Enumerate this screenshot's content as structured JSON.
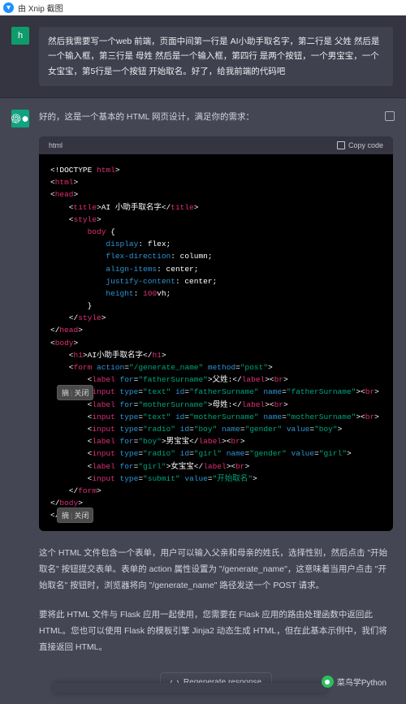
{
  "titlebar": {
    "text": "由 Xnip 截图"
  },
  "user": {
    "avatar_letter": "h",
    "message": "然后我需要写一个web 前端，页面中间第一行是 AI小助手取名字，第二行是 父姓 然后是一个输入框，第三行是 母姓 然后是一个输入框，第四行 是两个按钮，一个男宝宝，一个女宝宝，第5行是一个按钮 开始取名。好了，给我前端的代码吧"
  },
  "assistant": {
    "intro": "好的，这是一个基本的 HTML 网页设计，满足你的需求：",
    "code_lang": "html",
    "copy_label": "Copy code",
    "para1": "这个 HTML 文件包含一个表单，用户可以输入父亲和母亲的姓氏，选择性别，然后点击 \"开始取名\" 按钮提交表单。表单的 action 属性设置为 \"/generate_name\"，这意味着当用户点击 \"开始取名\" 按钮时，浏览器将向 \"/generate_name\" 路径发送一个 POST 请求。",
    "para2": "要将此 HTML 文件与 Flask 应用一起使用，您需要在 Flask 应用的路由处理函数中返回此 HTML。您也可以使用 Flask 的模板引擎 Jinja2 动态生成 HTML，但在此基本示例中，我们将直接返回 HTML。"
  },
  "code": {
    "title": "AI 小助手取名字",
    "display": "flex",
    "flexDirection": "column",
    "alignItems": "center",
    "justifyContent": "center",
    "height": "100",
    "heightUnit": "vh",
    "h1": "AI小助手取名字",
    "formAction": "/generate_name",
    "formMethod": "post",
    "labelFatherFor": "fatherSurname",
    "labelFatherText": "父姓:",
    "inputText": "text",
    "inputFatherId": "fatherSurname",
    "inputFatherName": "fatherSurname",
    "labelMotherFor": "motherSurname",
    "labelMotherText": "母姓:",
    "inputMotherId": "motherSurname",
    "inputMotherName": "motherSurname",
    "inputRadio": "radio",
    "inputBoyId": "boy",
    "genderName": "gender",
    "boyValue": "boy",
    "labelBoyFor": "boy",
    "labelBoyText": "男宝宝",
    "inputGirlId": "girl",
    "girlValue": "girl",
    "labelGirlFor": "girl",
    "labelGirlText": "女宝宝",
    "inputSubmit": "submit",
    "submitValue": "开始取名"
  },
  "overlay": {
    "pick": "摘",
    "close": "关闭"
  },
  "regen_label": "Regenerate response",
  "watermark": "菜鸟学Python"
}
